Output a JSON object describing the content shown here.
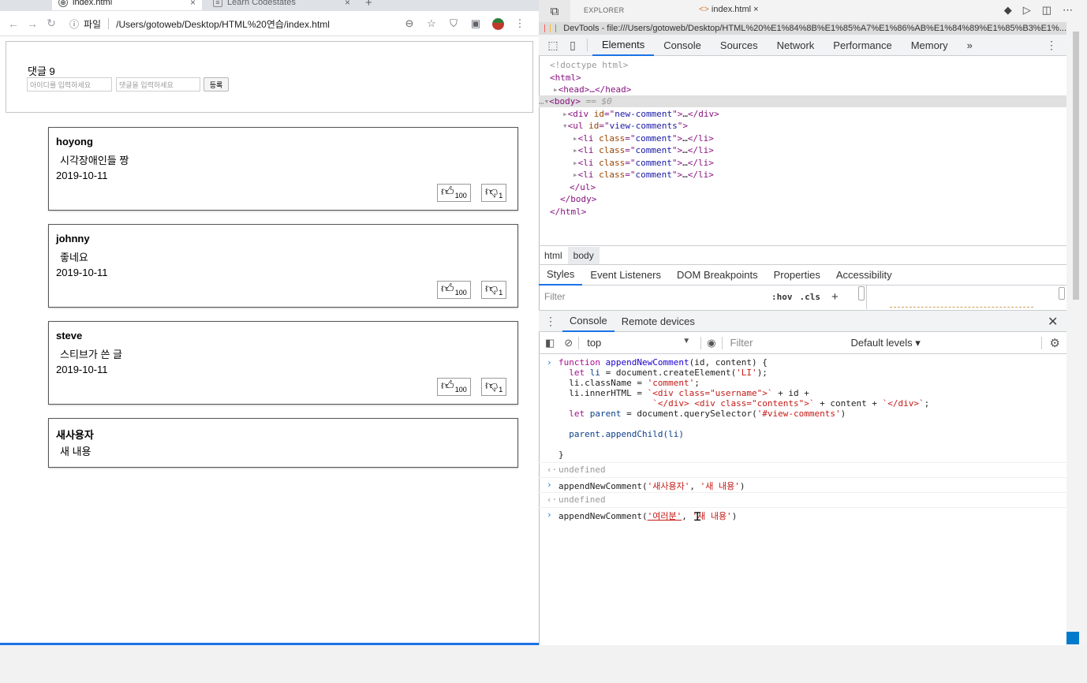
{
  "browser": {
    "tabs": [
      {
        "title": "index.html",
        "close": "×"
      },
      {
        "title": "Learn Codestates",
        "close": "×"
      }
    ],
    "new_tab": "+",
    "address": {
      "scheme_label": "파일",
      "path": "/Users/gotoweb/Desktop/HTML%20연습/index.html"
    }
  },
  "page": {
    "comment_count": "댓글 9",
    "id_placeholder": "아이디를 입력하세요",
    "content_placeholder": "댓글을 입력하세요",
    "submit_label": "등록",
    "comments": [
      {
        "username": "hoyong",
        "content": "시각장애인들 짱",
        "date": "2019-10-11",
        "likes": "100",
        "dislikes": "1"
      },
      {
        "username": "johnny",
        "content": "좋네요",
        "date": "2019-10-11",
        "likes": "100",
        "dislikes": "1"
      },
      {
        "username": "steve",
        "content": "스티브가 쓴 글",
        "date": "2019-10-11",
        "likes": "100",
        "dislikes": "1"
      },
      {
        "username": "새사용자",
        "content": "새 내용"
      }
    ]
  },
  "vscode": {
    "explorer_label": "EXPLORER",
    "file_tab": "index.html",
    "file_tab_close": "×"
  },
  "devtools": {
    "window_title": "DevTools - file:///Users/gotoweb/Desktop/HTML%20%E1%84%8B%E1%85%A7%E1%86%AB%E1%84%89%E1%85%B3%E1%...",
    "tabs": [
      "Elements",
      "Console",
      "Sources",
      "Network",
      "Performance",
      "Memory",
      "»"
    ],
    "elements": {
      "doctype": "<!doctype html>",
      "html_open": "<html>",
      "head": "<head>…</head>",
      "body_open": "<body>",
      "body_marker": "== $0",
      "div": {
        "tag": "div",
        "attr": "id",
        "value": "new-comment"
      },
      "ul": {
        "tag": "ul",
        "attr": "id",
        "value": "view-comments"
      },
      "li": {
        "tag": "li",
        "attr": "class",
        "value": "comment"
      },
      "ul_close": "</ul>",
      "body_close": "</body>",
      "html_close": "</html>"
    },
    "breadcrumbs": [
      "html",
      "body"
    ],
    "subtabs": [
      "Styles",
      "Event Listeners",
      "DOM Breakpoints",
      "Properties",
      "Accessibility"
    ],
    "style_filter_placeholder": "Filter",
    "hov": ":hov",
    "cls": ".cls",
    "plus": "+",
    "drawer_tabs": [
      "Console",
      "Remote devices"
    ],
    "console_context": "top",
    "console_filter_placeholder": "Filter",
    "levels": "Default levels ▾",
    "console_lines": {
      "l1a": "function ",
      "l1b": "appendNewComment",
      "l1c": "(id, content) {",
      "l2a": "  let ",
      "l2b": "li",
      "l2c": " = document.createElement(",
      "l2d": "'LI'",
      "l2e": ");",
      "l3a": "  li.className = ",
      "l3b": "'comment'",
      "l3c": ";",
      "l4a": "  li.innerHTML = ",
      "l4b": "`<div class=\"username\">`",
      "l4c": " + id +",
      "l5a": "                  ",
      "l5b": "`</div> <div class=\"contents\">`",
      "l5c": " + content + ",
      "l5d": "`</div>`",
      "l5e": ";",
      "l6a": "  let ",
      "l6b": "parent",
      "l6c": " = document.querySelector(",
      "l6d": "'#view-comments'",
      "l6e": ")",
      "l7": "  parent.appendChild(li)",
      "l8": "}",
      "undefined": "undefined",
      "call1a": "appendNewComment(",
      "call1b": "'새사용자'",
      "call1c": ", ",
      "call1d": "'새 내용'",
      "call1e": ")",
      "call2a": "appendNewComment(",
      "call2b": "'여러분'",
      "call2c": ", ",
      "call2d": "'새 내용'",
      "call2e": ")"
    }
  }
}
